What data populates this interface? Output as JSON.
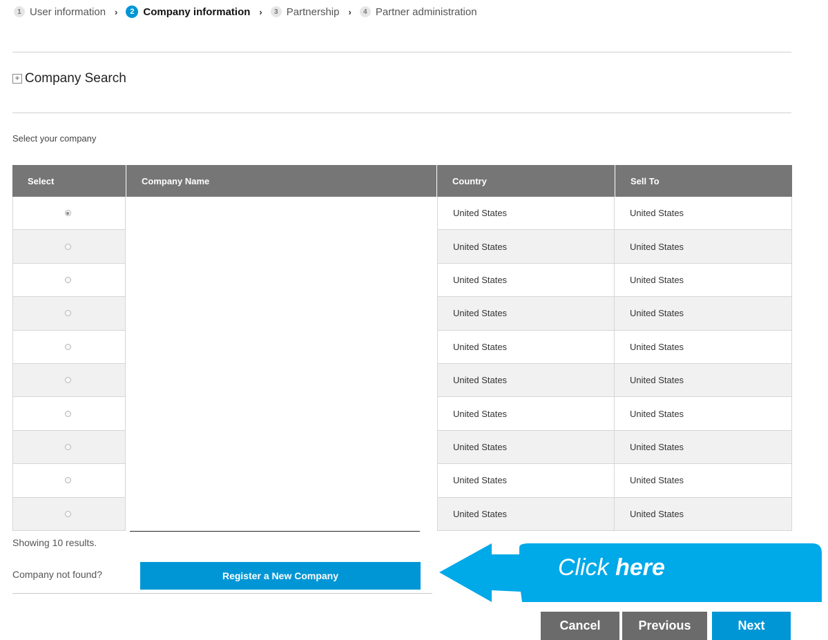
{
  "stepper": {
    "steps": [
      {
        "num": "1",
        "label": "User information"
      },
      {
        "num": "2",
        "label": "Company information"
      },
      {
        "num": "3",
        "label": "Partnership"
      },
      {
        "num": "4",
        "label": "Partner administration"
      }
    ],
    "chevron": "›"
  },
  "search": {
    "plus": "+",
    "title": "Company Search"
  },
  "select_label": "Select your company",
  "table": {
    "headers": {
      "select": "Select",
      "company_name": "Company Name",
      "country": "Country",
      "sell_to": "Sell To"
    },
    "rows": [
      {
        "country": "United States",
        "sell_to": "United States",
        "selected": true
      },
      {
        "country": "United States",
        "sell_to": "United States",
        "selected": false
      },
      {
        "country": "United States",
        "sell_to": "United States",
        "selected": false
      },
      {
        "country": "United States",
        "sell_to": "United States",
        "selected": false
      },
      {
        "country": "United States",
        "sell_to": "United States",
        "selected": false
      },
      {
        "country": "United States",
        "sell_to": "United States",
        "selected": false
      },
      {
        "country": "United States",
        "sell_to": "United States",
        "selected": false
      },
      {
        "country": "United States",
        "sell_to": "United States",
        "selected": false
      },
      {
        "country": "United States",
        "sell_to": "United States",
        "selected": false
      },
      {
        "country": "United States",
        "sell_to": "United States",
        "selected": false
      }
    ]
  },
  "showing": "Showing 10 results.",
  "not_found": "Company not found?",
  "register_label": "Register a New Company",
  "callout": {
    "prefix": "Click ",
    "emphasis": "here"
  },
  "buttons": {
    "cancel": "Cancel",
    "previous": "Previous",
    "next": "Next"
  },
  "colors": {
    "accent": "#0096d6",
    "callout": "#00a9e8",
    "header_gray": "#767676",
    "button_gray": "#6b6b6b"
  }
}
